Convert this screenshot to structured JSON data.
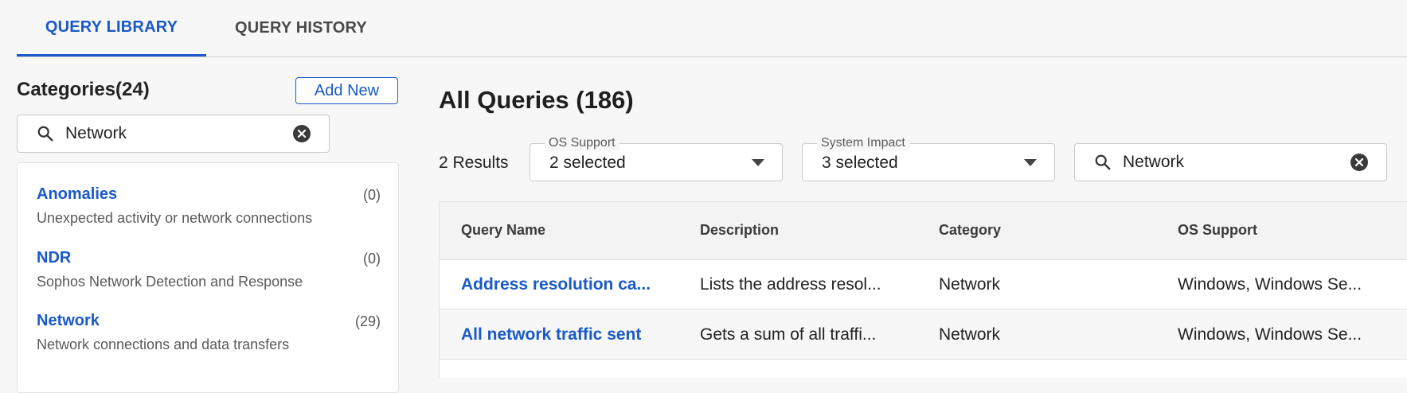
{
  "tabs": [
    {
      "label": "QUERY LIBRARY",
      "active": true
    },
    {
      "label": "QUERY HISTORY",
      "active": false
    }
  ],
  "sidebar": {
    "title": "Categories(24)",
    "add_button": "Add New",
    "search_value": "Network",
    "categories": [
      {
        "name": "Anomalies",
        "count": "(0)",
        "description": "Unexpected activity or network connections"
      },
      {
        "name": "NDR",
        "count": "(0)",
        "description": "Sophos Network Detection and Response"
      },
      {
        "name": "Network",
        "count": "(29)",
        "description": "Network connections and data transfers"
      }
    ]
  },
  "main": {
    "title": "All Queries (186)",
    "results": "2 Results",
    "filters": {
      "os_support": {
        "label": "OS Support",
        "value": "2 selected"
      },
      "system_impact": {
        "label": "System Impact",
        "value": "3 selected"
      }
    },
    "search_value": "Network",
    "table": {
      "columns": [
        "Query Name",
        "Description",
        "Category",
        "OS Support"
      ],
      "rows": [
        {
          "name": "Address resolution ca...",
          "description": "Lists the address resol...",
          "category": "Network",
          "os": "Windows, Windows Se..."
        },
        {
          "name": "All network traffic sent",
          "description": "Gets a sum of all traffi...",
          "category": "Network",
          "os": "Windows, Windows Se..."
        }
      ]
    }
  },
  "colors": {
    "accent": "#1a5ac8",
    "background": "#f7f7f7"
  },
  "icons": {
    "search": "search-icon",
    "clear": "clear-icon",
    "dropdown": "chevron-down-icon"
  }
}
